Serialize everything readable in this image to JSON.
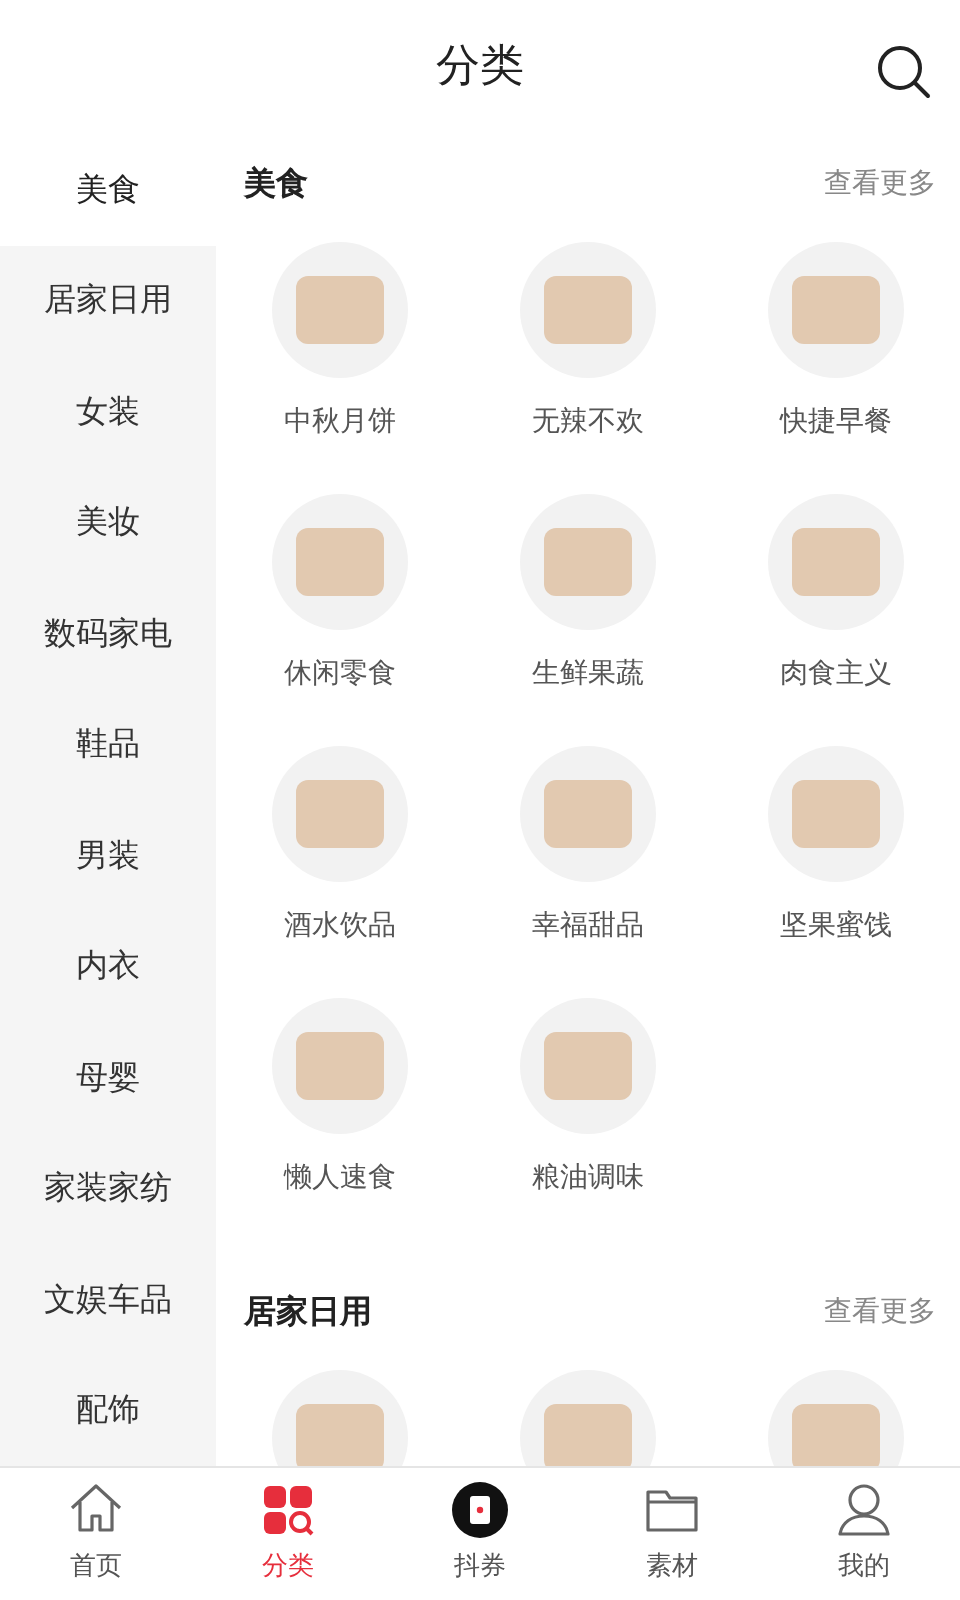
{
  "header": {
    "title": "分类"
  },
  "sidebar": {
    "items": [
      {
        "label": "美食",
        "selected": true
      },
      {
        "label": "居家日用",
        "selected": false
      },
      {
        "label": "女装",
        "selected": false
      },
      {
        "label": "美妆",
        "selected": false
      },
      {
        "label": "数码家电",
        "selected": false
      },
      {
        "label": "鞋品",
        "selected": false
      },
      {
        "label": "男装",
        "selected": false
      },
      {
        "label": "内衣",
        "selected": false
      },
      {
        "label": "母婴",
        "selected": false
      },
      {
        "label": "家装家纺",
        "selected": false
      },
      {
        "label": "文娱车品",
        "selected": false
      },
      {
        "label": "配饰",
        "selected": false
      }
    ]
  },
  "sections": [
    {
      "title": "美食",
      "more": "查看更多",
      "items": [
        {
          "kind": "product",
          "label": "中秋月饼"
        },
        {
          "kind": "product",
          "label": "无辣不欢"
        },
        {
          "kind": "product",
          "label": "快捷早餐"
        },
        {
          "kind": "product",
          "label": "休闲零食"
        },
        {
          "kind": "product",
          "label": "生鲜果蔬"
        },
        {
          "kind": "product",
          "label": "肉食主义"
        },
        {
          "kind": "product",
          "label": "酒水饮品"
        },
        {
          "kind": "product",
          "label": "幸福甜品"
        },
        {
          "kind": "product",
          "label": "坚果蜜饯"
        },
        {
          "kind": "product",
          "label": "懒人速食"
        },
        {
          "kind": "product",
          "label": "粮油调味"
        }
      ]
    },
    {
      "title": "居家日用",
      "more": "查看更多",
      "items": [
        {
          "kind": "product"
        },
        {
          "kind": "product"
        },
        {
          "kind": "product"
        }
      ]
    }
  ],
  "tab_bar": [
    {
      "kind": "home",
      "label": "首页",
      "selected": false
    },
    {
      "kind": "category",
      "label": "分类",
      "selected": true
    },
    {
      "kind": "coupon",
      "label": "抖券",
      "selected": false
    },
    {
      "kind": "folder",
      "label": "素材",
      "selected": false
    },
    {
      "kind": "person",
      "label": "我的",
      "selected": false
    }
  ]
}
